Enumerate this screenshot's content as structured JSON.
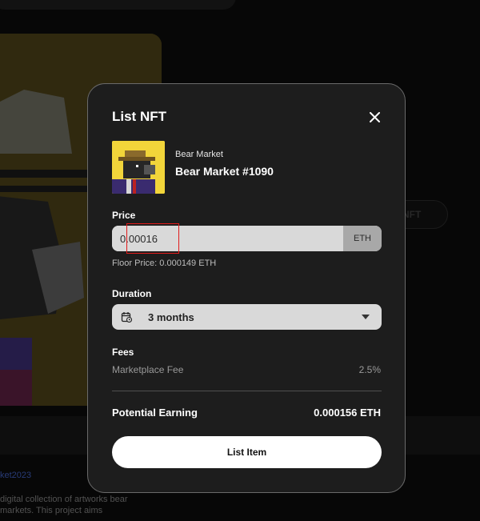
{
  "modal": {
    "title": "List NFT",
    "close_icon": "close-icon"
  },
  "item": {
    "collection": "Bear Market",
    "name": "Bear Market #1090",
    "thumbnail_bg": "#f2d53a"
  },
  "price": {
    "label": "Price",
    "value": "0.00016",
    "unit": "ETH",
    "floor_text": "Floor Price: 0.000149 ETH"
  },
  "duration": {
    "label": "Duration",
    "selected": "3 months",
    "icon": "calendar-icon"
  },
  "fees": {
    "label": "Fees",
    "items": [
      {
        "name": "Marketplace Fee",
        "value": "2.5%"
      }
    ]
  },
  "earning": {
    "label": "Potential Earning",
    "value": "0.000156 ETH"
  },
  "actions": {
    "list_label": "List Item"
  },
  "background": {
    "list_button_partial": "NFT",
    "link_partial": "ket2023",
    "description_partial": "digital collection of artworks bear markets. This project aims"
  },
  "colors": {
    "modal_bg": "#1d1d1d",
    "annotation_red": "#e11b1b"
  }
}
